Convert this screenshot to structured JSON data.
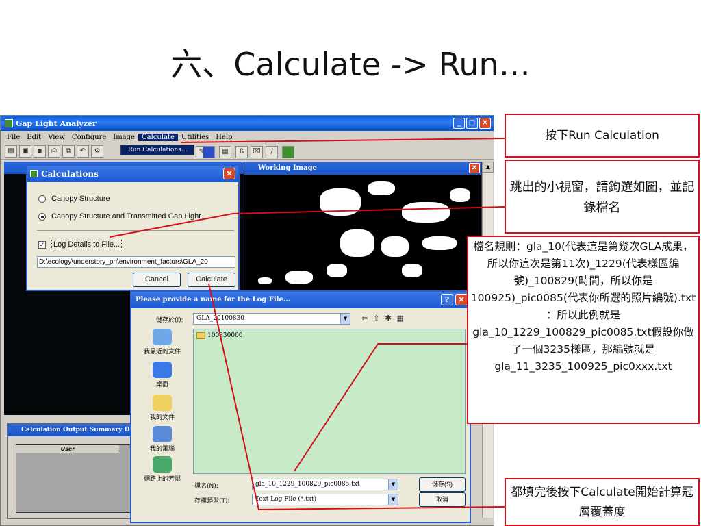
{
  "slide": {
    "title": "六、Calculate -> Run…"
  },
  "app": {
    "title": "Gap Light Analyzer",
    "menu": [
      "File",
      "Edit",
      "View",
      "Configure",
      "Image",
      "Calculate",
      "Utilities",
      "Help"
    ],
    "active_menu": "Calculate",
    "dropdown_item": "Run Calculations...",
    "working_image_title": "Working Image",
    "summary_title": "Calculation Output Summary Da",
    "summary_header": "User"
  },
  "calc_dialog": {
    "title": "Calculations",
    "option1": "Canopy Structure",
    "option2": "Canopy Structure and Transmitted Gap Light",
    "selected": "option2",
    "log_checkbox": "Log Details to File...",
    "log_checked": true,
    "path": "D:\\ecology\\understory_pri\\environment_factors\\GLA_20",
    "cancel": "Cancel",
    "calculate": "Calculate"
  },
  "save_dialog": {
    "title": "Please provide a name for the Log File...",
    "save_in_label": "儲存於(I):",
    "save_in_value": "GLA_20100830",
    "folder_item": "100830000",
    "places": [
      "我最近的文件",
      "桌面",
      "我的文件",
      "我的電腦",
      "網路上的芳鄰"
    ],
    "filename_label": "檔名(N):",
    "filename_value": "gla_10_1229_100829_pic0085.txt",
    "filetype_label": "存檔類型(T):",
    "filetype_value": "Text Log File (*.txt)",
    "save_button": "儲存(S)",
    "cancel_button": "取消"
  },
  "callouts": {
    "c1": "按下Run Calculation",
    "c2": "跳出的小視窗，請鉤選如圖，並記錄檔名",
    "c3": "檔名規則：gla_10(代表這是第幾次GLA成果，所以你這次是第11次)_1229(代表樣區編號)_100829(時間，所以你是100925)_pic0085(代表你所選的照片編號).txt ：所以此例就是gla_10_1229_100829_pic0085.txt假設你做了一個3235樣區，那編號就是gla_11_3235_100925_pic0xxx.txt",
    "c4": "都填完後按下Calculate開始計算冠層覆蓋度"
  },
  "colors": {
    "callout_border": "#d0101a",
    "file_list_bg": "#c7eac8",
    "titlebar": "#1c5ad0"
  }
}
